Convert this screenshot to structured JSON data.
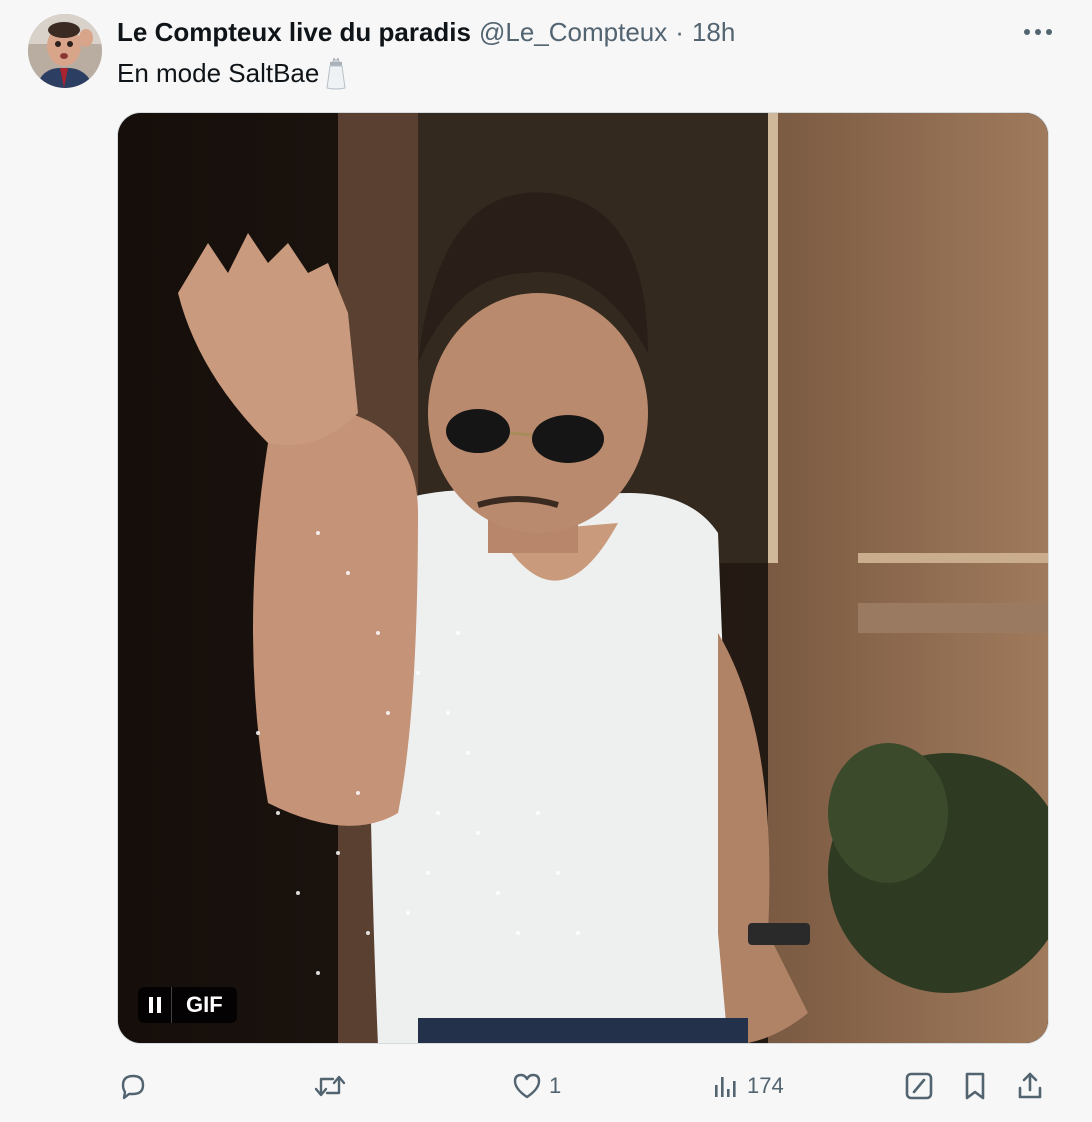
{
  "tweet": {
    "display_name": "Le Compteux live du paradis",
    "handle": "@Le_Compteux",
    "separator": "·",
    "time": "18h",
    "text": "En mode SaltBae",
    "emoji_icon": "salt-shaker-icon"
  },
  "media": {
    "type": "gif",
    "gif_badge": "GIF",
    "state": "playing",
    "pause_icon": "pause-icon"
  },
  "actions": {
    "reply_count": "",
    "retweet_count": "",
    "like_count": "1",
    "views_count": "174"
  },
  "colors": {
    "background": "#f7f7f7",
    "text_primary": "#0f1419",
    "text_secondary": "#536471"
  }
}
